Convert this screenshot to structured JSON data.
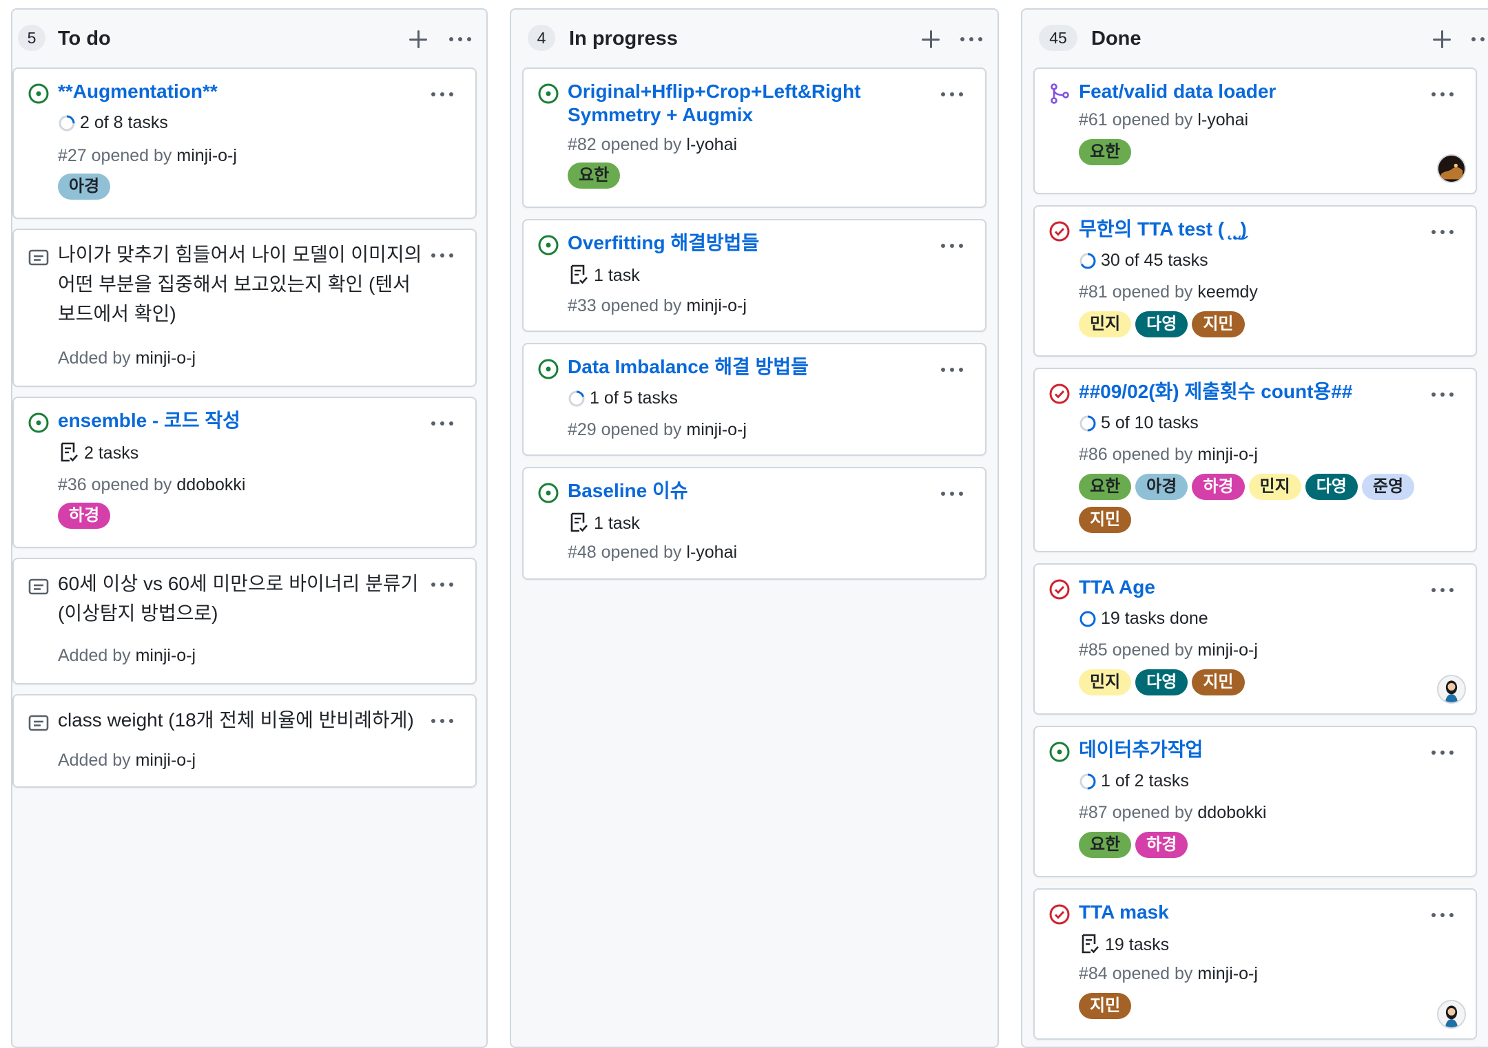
{
  "columns": [
    {
      "count": "5",
      "title": "To do"
    },
    {
      "count": "4",
      "title": "In progress"
    },
    {
      "count": "45",
      "title": "Done"
    }
  ],
  "todo": [
    {
      "title": "**Augmentation**",
      "tasks": "2 of 8 tasks",
      "meta": "#27 opened by ",
      "user": "minji-o-j",
      "labels": [
        "아경"
      ]
    },
    {
      "note": "나이가 맞추기 힘들어서 나이 모델이 이미지의 어떤 부분을 집중해서 보고있는지 확인 (텐서보드에서 확인)",
      "added": "Added by ",
      "user": "minji-o-j"
    },
    {
      "title": "ensemble - 코드 작성",
      "tasks": "2 tasks",
      "meta": "#36 opened by ",
      "user": "ddobokki",
      "labels": [
        "하경"
      ]
    },
    {
      "note": "60세 이상 vs 60세 미만으로 바이너리 분류기 (이상탐지 방법으로)",
      "added": "Added by ",
      "user": "minji-o-j"
    },
    {
      "note": "class weight (18개 전체 비율에 반비례하게)",
      "added": "Added by ",
      "user": "minji-o-j"
    }
  ],
  "inprogress": [
    {
      "title": "Original+Hflip+Crop+Left&Right Symmetry + Augmix",
      "meta": "#82 opened by ",
      "user": "l-yohai",
      "labels": [
        "요한"
      ]
    },
    {
      "title": "Overfitting 해결방법들",
      "tasks": "1 task",
      "meta": "#33 opened by ",
      "user": "minji-o-j"
    },
    {
      "title": "Data Imbalance 해결 방법들",
      "tasks": "1 of 5 tasks",
      "meta": "#29 opened by ",
      "user": "minji-o-j"
    },
    {
      "title": "Baseline 이슈",
      "tasks": "1 task",
      "meta": "#48 opened by ",
      "user": "l-yohai"
    }
  ],
  "done": [
    {
      "title": "Feat/valid data loader",
      "meta": "#61 opened by ",
      "user": "l-yohai",
      "labels": [
        "요한"
      ]
    },
    {
      "title": "무한의 TTA test ( ̨ ̨͜ ̨)",
      "tasks": "30 of 45 tasks",
      "meta": "#81 opened by ",
      "user": "keemdy",
      "labels": [
        "민지",
        "다영",
        "지민"
      ]
    },
    {
      "title": "##09/02(화) 제출횟수 count용##",
      "tasks": "5 of 10 tasks",
      "meta": "#86 opened by ",
      "user": "minji-o-j",
      "labels": [
        "요한",
        "아경",
        "하경",
        "민지",
        "다영",
        "준영",
        "지민"
      ]
    },
    {
      "title": "TTA Age",
      "tasks": "19 tasks done",
      "meta": "#85 opened by ",
      "user": "minji-o-j",
      "labels": [
        "민지",
        "다영",
        "지민"
      ]
    },
    {
      "title": "데이터추가작업",
      "tasks": "1 of 2 tasks",
      "meta": "#87 opened by ",
      "user": "ddobokki",
      "labels": [
        "요한",
        "하경"
      ]
    },
    {
      "title": "TTA mask",
      "tasks": "19 tasks",
      "meta": "#84 opened by ",
      "user": "minji-o-j",
      "labels": [
        "지민"
      ]
    }
  ],
  "label_colors": {
    "요한": "#6aab4f",
    "아경": "#8fc0d6",
    "하경": "#d53fa9",
    "민지": "#fdf2a4",
    "다영": "#006b75",
    "준영": "#c9daf8",
    "지민": "#a56226"
  },
  "colors": {
    "open": "#1a7f37",
    "closed": "#cf222e",
    "merged": "#8250df",
    "link": "#0969da"
  }
}
